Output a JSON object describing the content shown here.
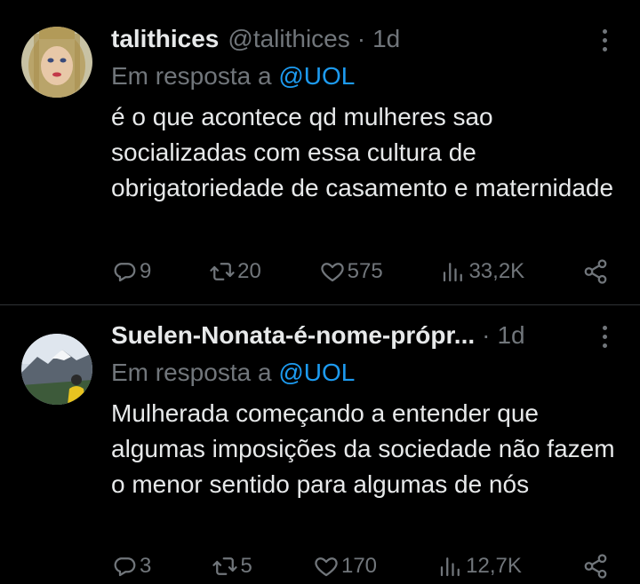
{
  "colors": {
    "background": "#000000",
    "text_primary": "#e7e9ea",
    "text_secondary": "#71767b",
    "link": "#1d9bf0",
    "divider": "#2f3336"
  },
  "tweets": [
    {
      "display_name": "talithices",
      "handle": "@talithices",
      "separator": "·",
      "time": "1d",
      "reply_prefix": "Em resposta a",
      "reply_mention": "@UOL",
      "text": "é o que acontece qd mulheres sao socializadas com essa cultura de obrigatoriedade de casamento e maternidade",
      "actions": {
        "replies": "9",
        "retweets": "20",
        "likes": "575",
        "views": "33,2K"
      },
      "icons": [
        "reply-icon",
        "retweet-icon",
        "like-icon",
        "views-icon",
        "share-icon",
        "more-icon"
      ]
    },
    {
      "display_name": "Suelen-Nonata-é-nome-própr...",
      "handle": "",
      "separator": "·",
      "time": "1d",
      "reply_prefix": "Em resposta a",
      "reply_mention": "@UOL",
      "text": "Mulherada começando a entender que algumas imposições da sociedade não fazem o menor sentido para algumas de nós",
      "actions": {
        "replies": "3",
        "retweets": "5",
        "likes": "170",
        "views": "12,7K"
      },
      "icons": [
        "reply-icon",
        "retweet-icon",
        "like-icon",
        "views-icon",
        "share-icon",
        "more-icon"
      ]
    }
  ]
}
